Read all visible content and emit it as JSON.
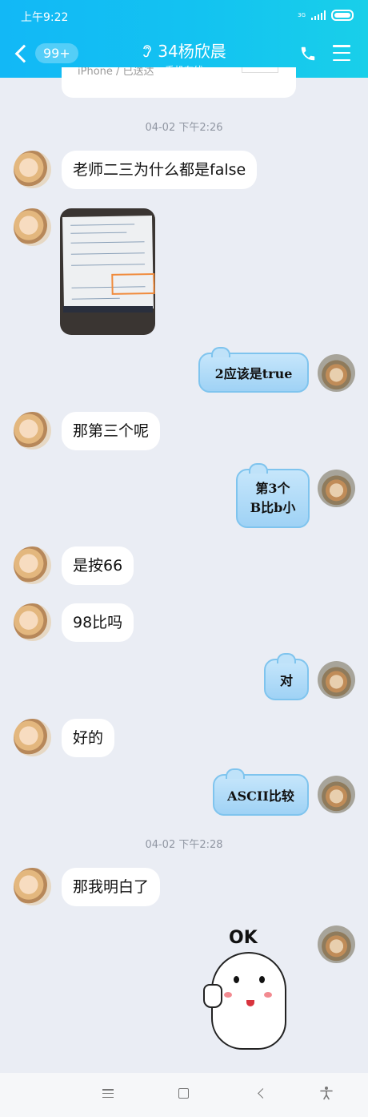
{
  "status_bar": {
    "time": "上午9:22",
    "network": "3G"
  },
  "header": {
    "unread_badge": "99+",
    "contact_name": "34杨欣晨",
    "contact_status": "手机在线"
  },
  "messages": {
    "cut_off_text": "iPhone / 已送达",
    "time_1": "04-02 下午2:26",
    "m1": "老师二三为什么都是false",
    "m3": "2应该是true",
    "m4": "那第三个呢",
    "m5_line1": "第3个",
    "m5_line2": "B比b小",
    "m6": "是按66",
    "m7": "98比吗",
    "m8": "对",
    "m9": "好的",
    "m10": "ASCII比较",
    "time_2": "04-02 下午2:28",
    "m11": "那我明白了",
    "sticker_text": "OK"
  },
  "colors": {
    "header_start": "#12b8f6",
    "header_end": "#19cfe9",
    "chat_background": "#eaedf4",
    "sent_bubble": "#a8d7f6"
  }
}
